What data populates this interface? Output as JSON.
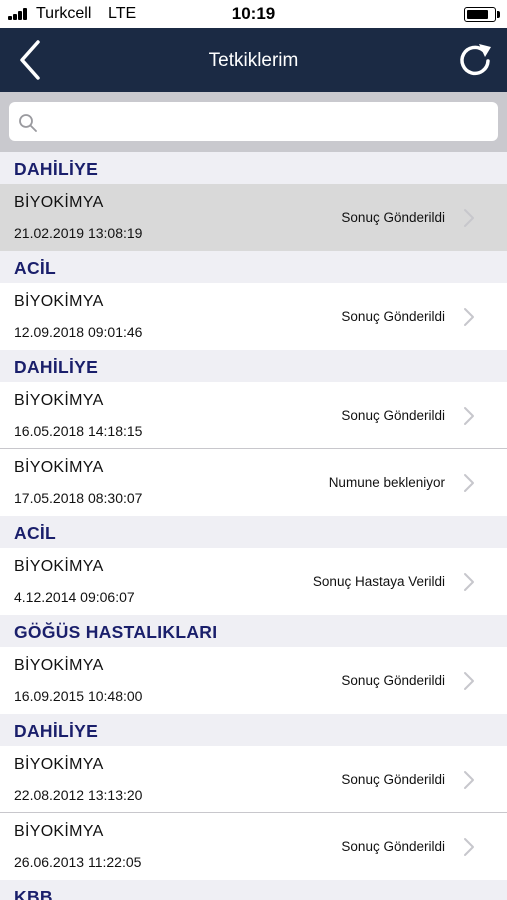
{
  "status_bar": {
    "carrier": "Turkcell",
    "network": "LTE",
    "time": "10:19",
    "battery_level": 0.85
  },
  "nav": {
    "title": "Tetkiklerim",
    "back_icon": "chevron-left-icon",
    "refresh_icon": "refresh-icon"
  },
  "search": {
    "placeholder": "",
    "value": ""
  },
  "sections": [
    {
      "header": "DAHİLİYE",
      "items": [
        {
          "title": "BİYOKİMYA",
          "date": "21.02.2019 13:08:19",
          "status": "Sonuç Gönderildi",
          "selected": true
        }
      ]
    },
    {
      "header": "ACİL",
      "items": [
        {
          "title": "BİYOKİMYA",
          "date": "12.09.2018 09:01:46",
          "status": "Sonuç Gönderildi"
        }
      ]
    },
    {
      "header": "DAHİLİYE",
      "items": [
        {
          "title": "BİYOKİMYA",
          "date": "16.05.2018 14:18:15",
          "status": "Sonuç Gönderildi"
        },
        {
          "title": "BİYOKİMYA",
          "date": "17.05.2018 08:30:07",
          "status": "Numune bekleniyor"
        }
      ]
    },
    {
      "header": "ACİL",
      "items": [
        {
          "title": "BİYOKİMYA",
          "date": "4.12.2014 09:06:07",
          "status": "Sonuç Hastaya Verildi"
        }
      ]
    },
    {
      "header": "GÖĞÜS HASTALIKLARI",
      "items": [
        {
          "title": "BİYOKİMYA",
          "date": "16.09.2015 10:48:00",
          "status": "Sonuç Gönderildi"
        }
      ]
    },
    {
      "header": "DAHİLİYE",
      "items": [
        {
          "title": "BİYOKİMYA",
          "date": "22.08.2012 13:13:20",
          "status": "Sonuç Gönderildi"
        },
        {
          "title": "BİYOKİMYA",
          "date": "26.06.2013 11:22:05",
          "status": "Sonuç Gönderildi"
        }
      ]
    },
    {
      "header": "KBB",
      "items": []
    }
  ],
  "colors": {
    "nav_background": "#1b2a44",
    "section_text": "#1a1f6b",
    "section_background": "#efeff4",
    "selected_row": "#d9d9d9",
    "chevron": "#c7c7cc"
  }
}
